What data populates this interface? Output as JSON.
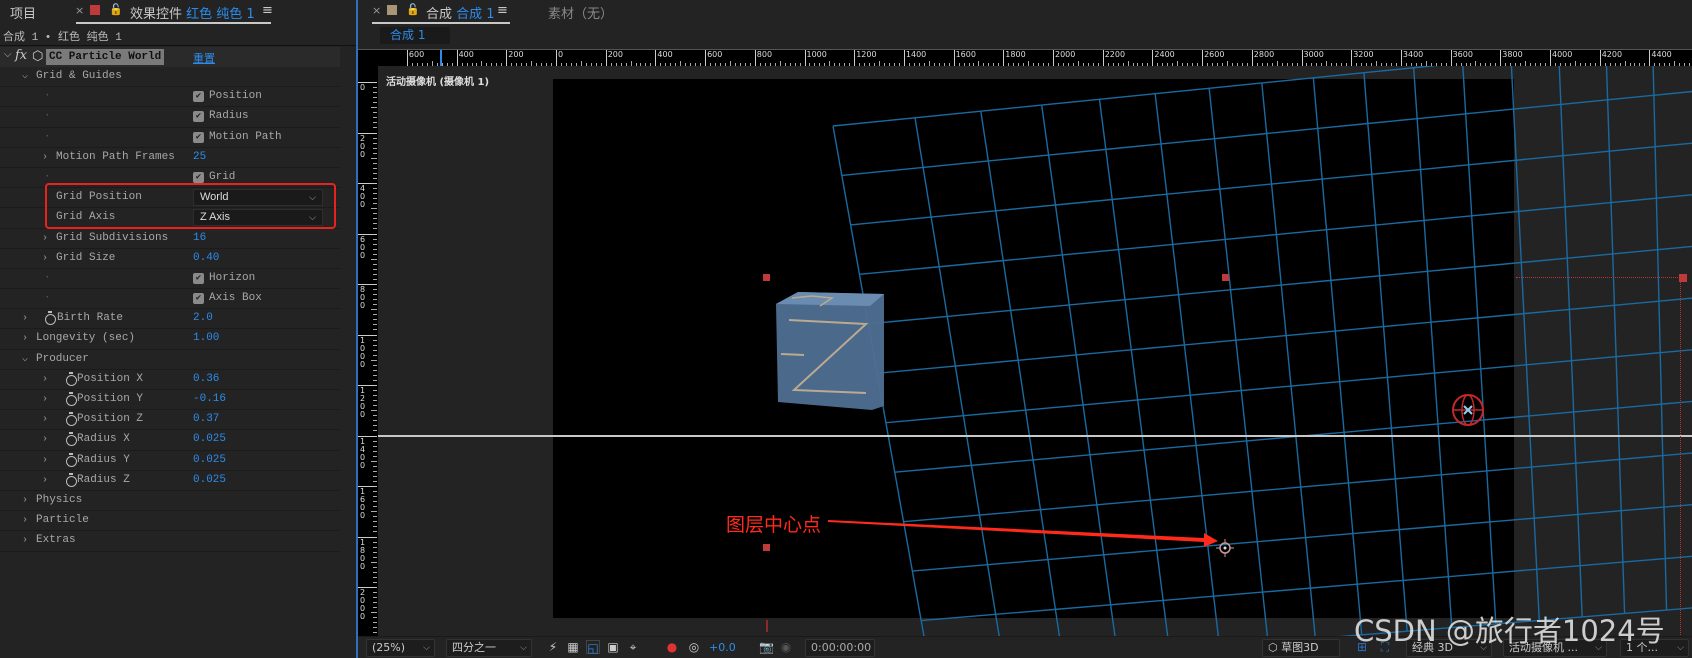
{
  "left_panel": {
    "tab_project": "项目",
    "tab_effects_prefix": "效果控件",
    "tab_effects_layer": "红色 纯色 1",
    "breadcrumb": "合成 1 • 红色 纯色 1",
    "effect_name": "CC Particle World",
    "reset": "重置",
    "rows": [
      {
        "type": "group",
        "indent": 1,
        "label": "Grid & Guides",
        "open": true
      },
      {
        "type": "check",
        "label": "Position",
        "checked": true
      },
      {
        "type": "check",
        "label": "Radius",
        "checked": true
      },
      {
        "type": "check",
        "label": "Motion Path",
        "checked": true
      },
      {
        "type": "value",
        "indent": 2,
        "label": "Motion Path Frames",
        "value": "25"
      },
      {
        "type": "check",
        "label": "Grid",
        "checked": true
      },
      {
        "type": "dropdown",
        "label": "Grid Position",
        "value": "World"
      },
      {
        "type": "dropdown",
        "label": "Grid Axis",
        "value": "Z Axis"
      },
      {
        "type": "value",
        "indent": 2,
        "label": "Grid Subdivisions",
        "value": "16"
      },
      {
        "type": "value",
        "indent": 2,
        "label": "Grid Size",
        "value": "0.40"
      },
      {
        "type": "check",
        "label": "Horizon",
        "checked": true
      },
      {
        "type": "check",
        "label": "Axis Box",
        "checked": true
      },
      {
        "type": "value",
        "indent": 1,
        "stopwatch": true,
        "label": "Birth Rate",
        "value": "2.0"
      },
      {
        "type": "value",
        "indent": 1,
        "label": "Longevity (sec)",
        "value": "1.00"
      },
      {
        "type": "group",
        "indent": 1,
        "label": "Producer",
        "open": true
      },
      {
        "type": "value",
        "indent": 3,
        "stopwatch": true,
        "label": "Position X",
        "value": "0.36"
      },
      {
        "type": "value",
        "indent": 3,
        "stopwatch": true,
        "label": "Position Y",
        "value": "-0.16"
      },
      {
        "type": "value",
        "indent": 3,
        "stopwatch": true,
        "label": "Position Z",
        "value": "0.37"
      },
      {
        "type": "value",
        "indent": 3,
        "stopwatch": true,
        "label": "Radius X",
        "value": "0.025"
      },
      {
        "type": "value",
        "indent": 3,
        "stopwatch": true,
        "label": "Radius Y",
        "value": "0.025"
      },
      {
        "type": "value",
        "indent": 3,
        "stopwatch": true,
        "label": "Radius Z",
        "value": "0.025"
      },
      {
        "type": "group",
        "indent": 1,
        "label": "Physics",
        "open": false
      },
      {
        "type": "group",
        "indent": 1,
        "label": "Particle",
        "open": false
      },
      {
        "type": "group",
        "indent": 1,
        "label": "Extras",
        "open": false
      }
    ]
  },
  "comp_panel": {
    "tab_prefix": "合成",
    "tab_comp": "合成 1",
    "tab_footage": "素材（无）",
    "comp_chip": "合成 1",
    "camera_label": "活动摄像机 (摄像机 1)",
    "h_ruler": [
      "600",
      "400",
      "200",
      "0",
      "200",
      "400",
      "600",
      "800",
      "1000",
      "1200",
      "1400",
      "1600",
      "1800",
      "2000",
      "2200",
      "2400",
      "2600",
      "2800",
      "3000",
      "3200",
      "3400",
      "3600",
      "3800",
      "4000",
      "4200",
      "4400"
    ],
    "v_ruler": [
      "0",
      "200",
      "400",
      "600",
      "800",
      "1000",
      "1200",
      "1400",
      "1600",
      "1800",
      "2000"
    ],
    "annotation": "图层中心点",
    "annotation_color": "#ff2a1a",
    "grid_color": "#1a6aa0"
  },
  "bottom_bar": {
    "zoom": "(25%)",
    "resolution": "四分之一",
    "exposure": "+0.0",
    "timecode": "0:00:00:00",
    "draft3d": "草图3D",
    "renderer": "经典 3D",
    "camera": "活动摄像机 ...",
    "views": "1 个..."
  },
  "watermark": "CSDN @旅行者1024号"
}
